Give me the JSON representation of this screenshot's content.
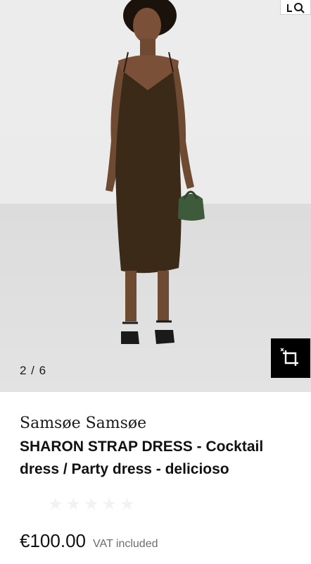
{
  "gallery": {
    "counter": "2 / 6",
    "icons": {
      "visual_search": "visual-search-icon",
      "crop": "crop-icon"
    }
  },
  "product": {
    "brand": "Samsøe Samsøe",
    "title": "SHARON STRAP DRESS - Cocktail dress / Party dress - delicioso",
    "rating": {
      "stars_filled": 0,
      "stars_total": 5
    },
    "price": "€100.00",
    "vat_note": "VAT included"
  },
  "colors": {
    "dress": "#3a2a17",
    "bag": "#3d5a3a",
    "crop_button_bg": "#000000"
  }
}
